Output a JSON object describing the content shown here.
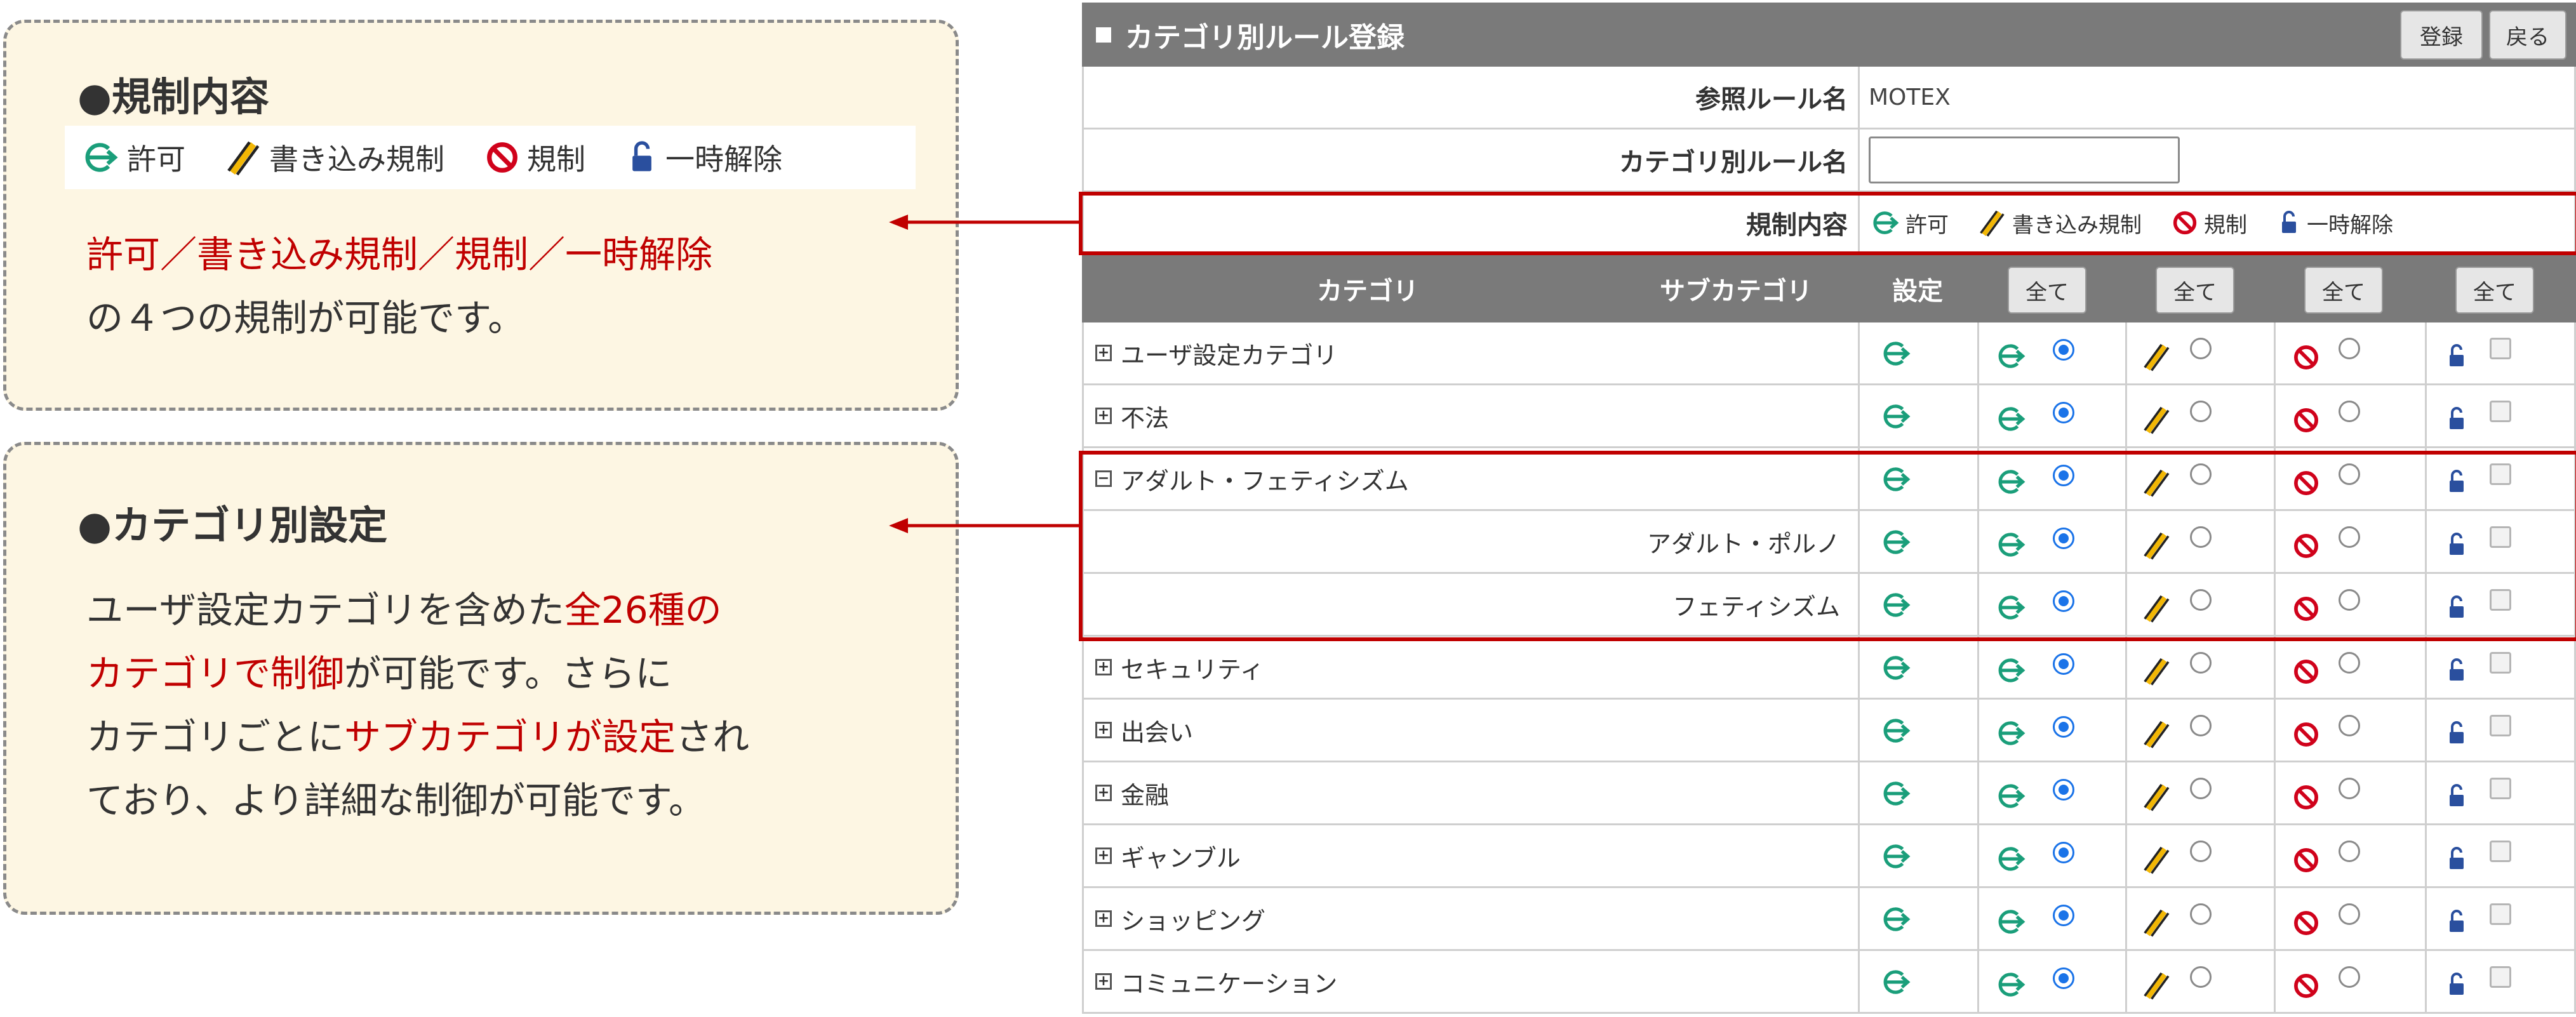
{
  "callouts": {
    "rules": {
      "title": "●規制内容",
      "legend": [
        "許可",
        "書き込み規制",
        "規制",
        "一時解除"
      ],
      "body_red": "許可／書き込み規制／規制／一時解除",
      "body_line2": "の４つの規制が可能です。"
    },
    "categories": {
      "title": "●カテゴリ別設定",
      "line1_a": "ユーザ設定カテゴリを含めた",
      "line1_b": "全26種の",
      "line2_a": "カテゴリで制御",
      "line2_b": "が可能です。さらに",
      "line3_a": "カテゴリごとに",
      "line3_b": "サブカテゴリが設定",
      "line3_c": "され",
      "line4": "ており、より詳細な制御が可能です。"
    }
  },
  "panel": {
    "title": "カテゴリ別ルール登録",
    "register_label": "登録",
    "back_label": "戻る",
    "ref_label": "参照ルール名",
    "ref_value": "MOTEX",
    "name_label": "カテゴリ別ルール名",
    "name_value": "",
    "rule_label": "規制内容",
    "legend": [
      "許可",
      "書き込み規制",
      "規制",
      "一時解除"
    ]
  },
  "table": {
    "headers": {
      "category": "カテゴリ",
      "subcategory": "サブカテゴリ",
      "setting": "設定",
      "all": "全て"
    },
    "rows": [
      {
        "name": "ユーザ設定カテゴリ",
        "expander": "+",
        "sub": false
      },
      {
        "name": "不法",
        "expander": "+",
        "sub": false
      },
      {
        "name": "アダルト・フェティシズム",
        "expander": "−",
        "sub": false
      },
      {
        "name": "アダルト・ポルノ",
        "expander": "",
        "sub": true
      },
      {
        "name": "フェティシズム",
        "expander": "",
        "sub": true
      },
      {
        "name": "セキュリティ",
        "expander": "+",
        "sub": false
      },
      {
        "name": "出会い",
        "expander": "+",
        "sub": false
      },
      {
        "name": "金融",
        "expander": "+",
        "sub": false
      },
      {
        "name": "ギャンブル",
        "expander": "+",
        "sub": false
      },
      {
        "name": "ショッピング",
        "expander": "+",
        "sub": false
      },
      {
        "name": "コミュニケーション",
        "expander": "+",
        "sub": false
      }
    ],
    "selected_option": "permit"
  },
  "colors": {
    "accent_red": "#c00000",
    "permit_green": "#1a9e7a",
    "block_red": "#d0021b",
    "lock_blue": "#2a4f9e",
    "header_gray": "#7a7a7a"
  },
  "icons": [
    "permit-icon",
    "write-block-icon",
    "block-icon",
    "unlock-icon",
    "expand-icon",
    "collapse-icon"
  ]
}
